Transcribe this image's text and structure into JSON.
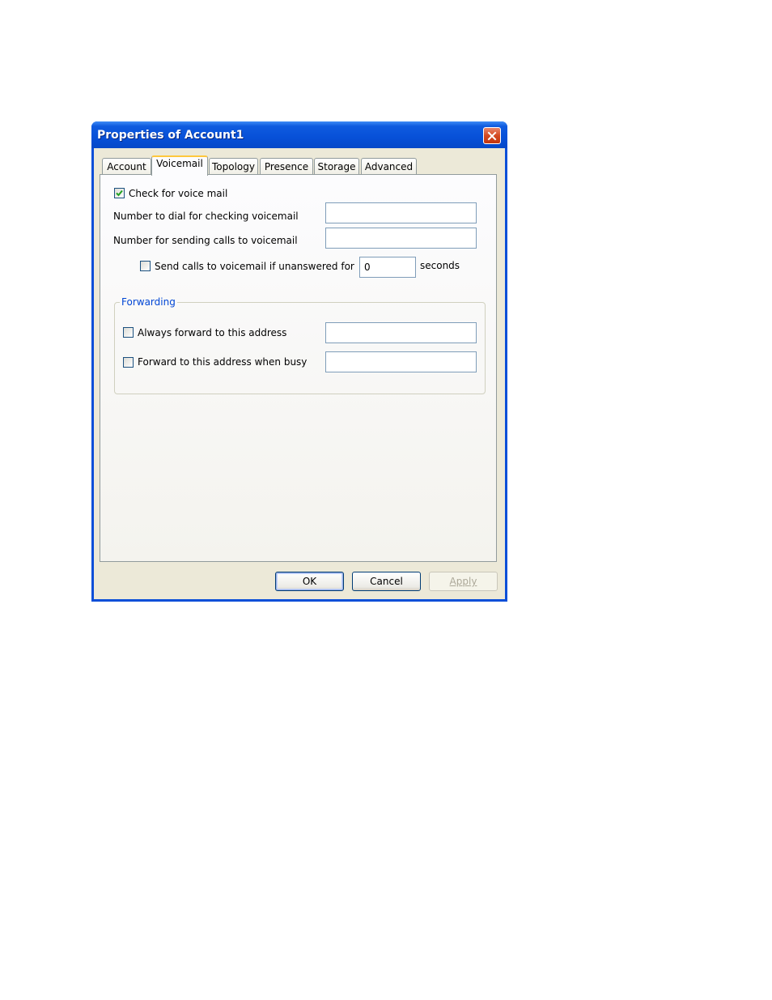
{
  "window": {
    "title": "Properties of Account1"
  },
  "tabs": [
    {
      "label": "Account"
    },
    {
      "label": "Voicemail"
    },
    {
      "label": "Topology"
    },
    {
      "label": "Presence"
    },
    {
      "label": "Storage"
    },
    {
      "label": "Advanced"
    }
  ],
  "voicemail": {
    "check_label": "Check for voice mail",
    "check_checked": true,
    "dial_label": "Number to dial for checking voicemail",
    "dial_value": "",
    "send_label": "Number for sending calls to voicemail",
    "send_value": "",
    "unanswered_label": "Send calls to voicemail if unanswered for",
    "unanswered_checked": false,
    "unanswered_value": "0",
    "seconds_label": "seconds"
  },
  "forwarding": {
    "legend": "Forwarding",
    "always_label": "Always forward to this address",
    "always_checked": false,
    "always_value": "",
    "busy_label": "Forward to this address when busy",
    "busy_checked": false,
    "busy_value": ""
  },
  "buttons": {
    "ok": "OK",
    "cancel": "Cancel",
    "apply": "Apply"
  },
  "colors": {
    "title_bar": "#0750d8",
    "dialog_face": "#ece9d8",
    "group_legend": "#0046d5",
    "check_mark": "#21a121"
  },
  "icons": {
    "close": "close-icon",
    "check": "checkmark-icon"
  }
}
